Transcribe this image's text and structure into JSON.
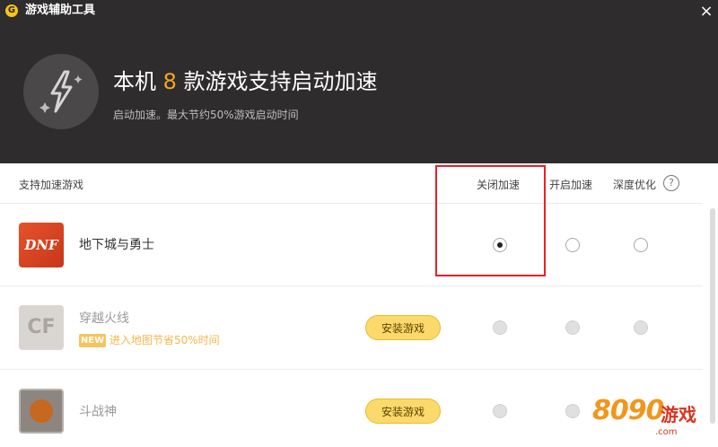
{
  "window": {
    "logo_letter": "G",
    "title": "游戏辅助工具",
    "close_glyph": "×"
  },
  "banner": {
    "headline_prefix": "本机",
    "game_count": "8",
    "headline_suffix": "款游戏支持启动加速",
    "subtitle": "启动加速。最大节约50%游戏启动时间",
    "icon": "lightning-icon"
  },
  "table": {
    "headers": {
      "games": "支持加速游戏",
      "disable": "关闭加速",
      "enable": "开启加速",
      "deep": "深度优化",
      "help": "?"
    },
    "rows": [
      {
        "name": "地下城与勇士",
        "icon_text": "DNF",
        "installed": true,
        "selected": "关闭加速"
      },
      {
        "name": "穿越火线",
        "icon_text": "CF",
        "installed": false,
        "badge": "NEW",
        "promo": "进入地图节省50%时间",
        "install_label": "安装游戏"
      },
      {
        "name": "斗战神",
        "installed": false,
        "install_label": "安装游戏"
      }
    ]
  },
  "watermark": {
    "digits": "8090",
    "word": "游戏",
    "domain": ".com"
  },
  "colors": {
    "header_bg": "#2e2c2d",
    "accent_orange": "#f5a623",
    "install_yellow": "#fbd96a",
    "highlight_red": "#e8202a"
  }
}
